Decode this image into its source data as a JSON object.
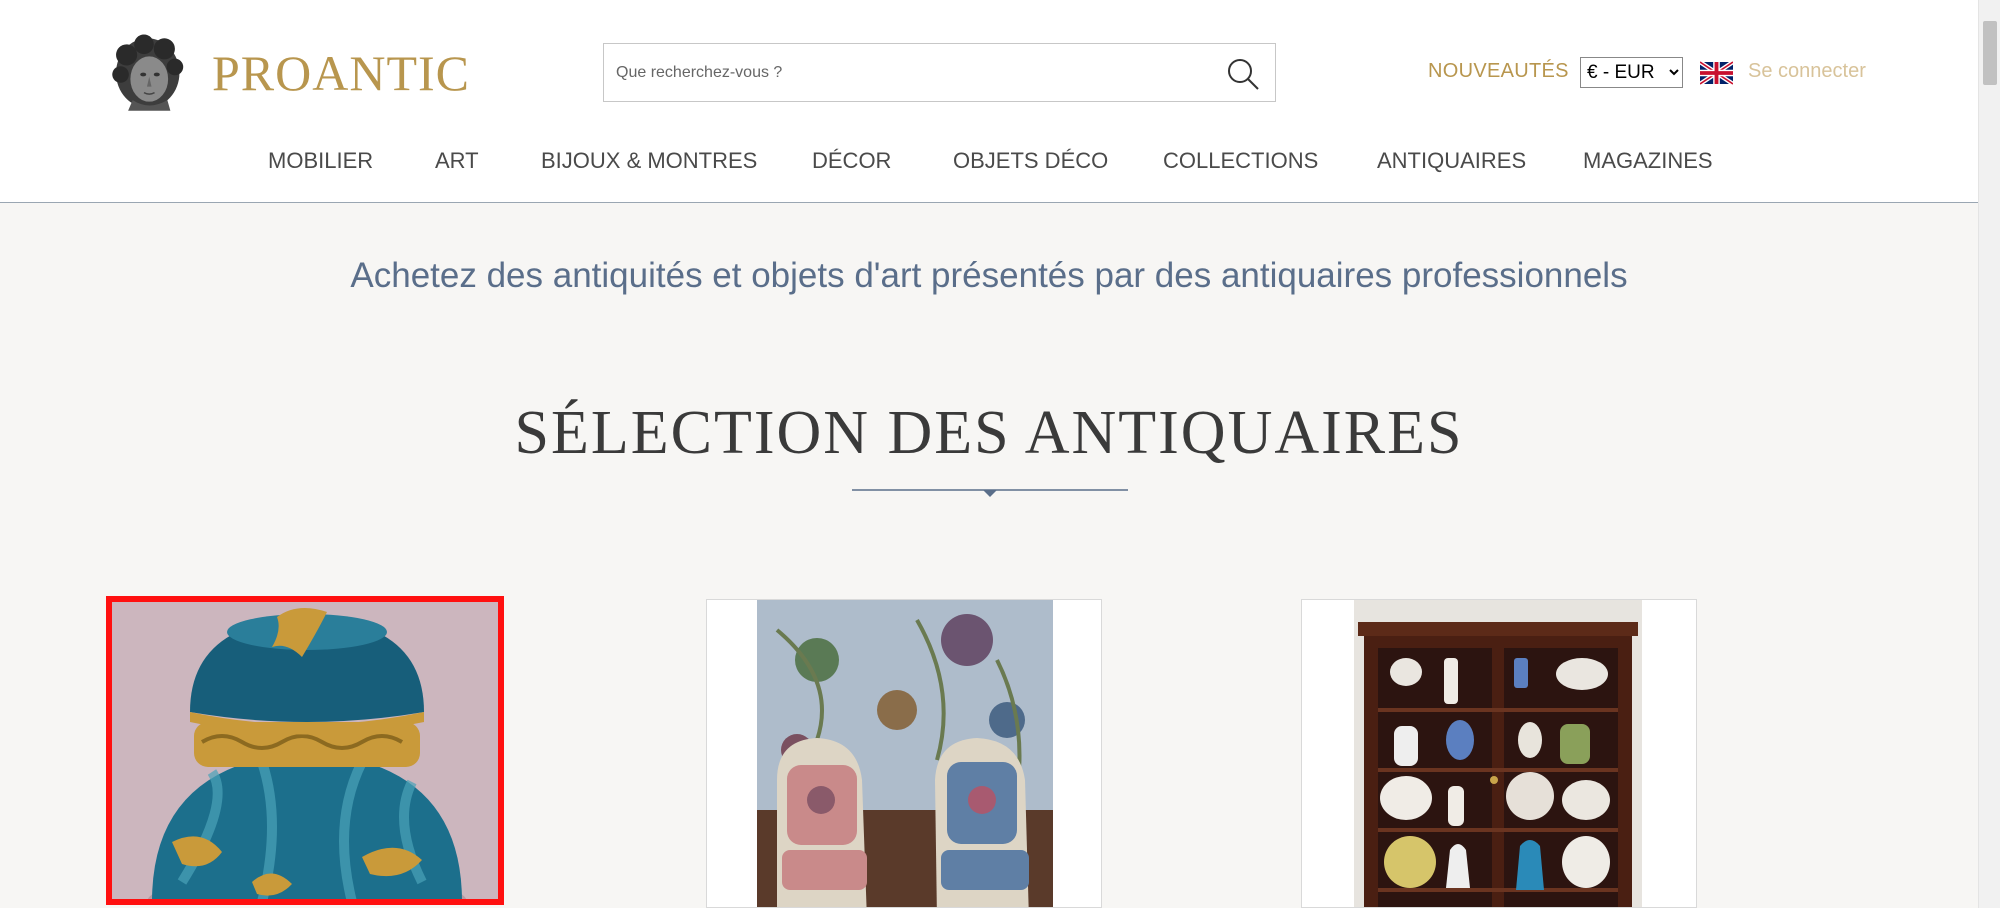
{
  "brand": {
    "name": "PROANTIC",
    "color": "#b8964e"
  },
  "search": {
    "placeholder": "Que recherchez-vous ?"
  },
  "header_links": {
    "new": "NOUVEAUTÉS",
    "login": "Se connecter"
  },
  "currency": {
    "selected": "€ - EUR"
  },
  "nav": [
    "MOBILIER",
    "ART",
    "BIJOUX & MONTRES",
    "DÉCOR",
    "OBJETS DÉCO",
    "COLLECTIONS",
    "ANTIQUAIRES",
    "MAGAZINES"
  ],
  "tagline": "Achetez des antiquités et objets d'art présentés par des antiquaires professionnels",
  "section_title": "SÉLECTION DES ANTIQUAIRES",
  "colors": {
    "accent_gold": "#b8964e",
    "nav_text": "#4a4a4a",
    "tagline_blue": "#5a6e8a",
    "selection_red": "#ff1010"
  }
}
